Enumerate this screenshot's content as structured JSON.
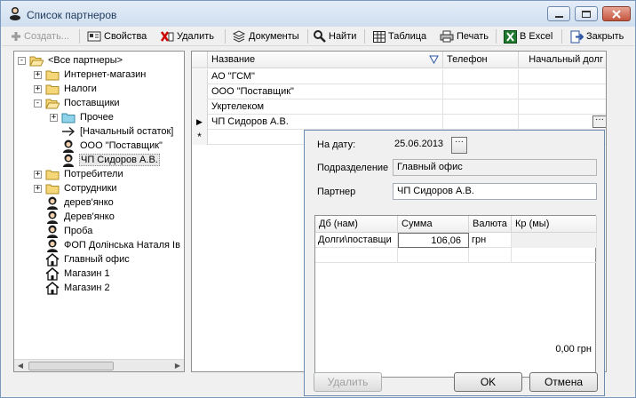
{
  "window": {
    "title": "Список партнеров"
  },
  "toolbar": {
    "create": "Создать...",
    "properties": "Свойства",
    "delete": "Удалить",
    "documents": "Документы",
    "find": "Найти",
    "table": "Таблица",
    "print": "Печать",
    "excel": "В Excel",
    "close": "Закрыть"
  },
  "tree": {
    "items": [
      {
        "label": "<Все партнеры>",
        "level": 0,
        "icon": "folder-open-icon",
        "expander": "-"
      },
      {
        "label": "Интернет-магазин",
        "level": 1,
        "icon": "folder-icon",
        "expander": "+"
      },
      {
        "label": "Налоги",
        "level": 1,
        "icon": "folder-icon",
        "expander": "+"
      },
      {
        "label": "Поставщики",
        "level": 1,
        "icon": "folder-open-icon",
        "expander": "-"
      },
      {
        "label": "Прочее",
        "level": 2,
        "icon": "folder-blue-icon",
        "expander": "+"
      },
      {
        "label": "[Начальный остаток]",
        "level": 2,
        "icon": "arrow-right-icon",
        "expander": ""
      },
      {
        "label": "ООО \"Поставщик\"",
        "level": 2,
        "icon": "person-icon",
        "expander": ""
      },
      {
        "label": "ЧП Сидоров А.В.",
        "level": 2,
        "icon": "person-icon",
        "expander": "",
        "selected": true
      },
      {
        "label": "Потребители",
        "level": 1,
        "icon": "folder-icon",
        "expander": "+"
      },
      {
        "label": "Сотрудники",
        "level": 1,
        "icon": "folder-icon",
        "expander": "+"
      },
      {
        "label": "дерев'янко",
        "level": 1,
        "icon": "person-icon",
        "expander": ""
      },
      {
        "label": "Дерев'янко",
        "level": 1,
        "icon": "person-icon",
        "expander": ""
      },
      {
        "label": "Проба",
        "level": 1,
        "icon": "person-icon",
        "expander": ""
      },
      {
        "label": "ФОП Долінська Наталя Ів",
        "level": 1,
        "icon": "person-icon",
        "expander": ""
      },
      {
        "label": "Главный офис",
        "level": 1,
        "icon": "house-icon",
        "expander": ""
      },
      {
        "label": "Магазин 1",
        "level": 1,
        "icon": "house-icon",
        "expander": ""
      },
      {
        "label": "Магазин 2",
        "level": 1,
        "icon": "house-icon",
        "expander": ""
      }
    ]
  },
  "grid": {
    "columns": [
      "Название",
      "Телефон",
      "Начальный долг"
    ],
    "rows": [
      {
        "name": "АО \"ГСМ\""
      },
      {
        "name": "ООО \"Поставщик\""
      },
      {
        "name": "Укртелеком"
      },
      {
        "name": "ЧП Сидоров А.В.",
        "current": true
      }
    ],
    "new_row_marker": "*",
    "current_marker": "▶",
    "ellipsis": "···"
  },
  "popup": {
    "date_label": "На дату:",
    "date_value": "25.06.2013",
    "ellipsis": "···",
    "division_label": "Подразделение",
    "division_value": "Главный офис",
    "partner_label": "Партнер",
    "partner_value": "ЧП Сидоров А.В.",
    "columns": [
      "Дб (нам)",
      "Сумма",
      "Валюта",
      "Кр (мы)"
    ],
    "row": {
      "debit": "Долги\\поставщи",
      "amount": "106,06",
      "currency": "грн",
      "credit": ""
    },
    "total": "0,00 грн",
    "delete_button": "Удалить",
    "ok_button": "OK",
    "cancel_button": "Отмена"
  },
  "colors": {
    "accent": "#1e395b",
    "close": "#c3553e",
    "excel": "#1d7a2e"
  }
}
